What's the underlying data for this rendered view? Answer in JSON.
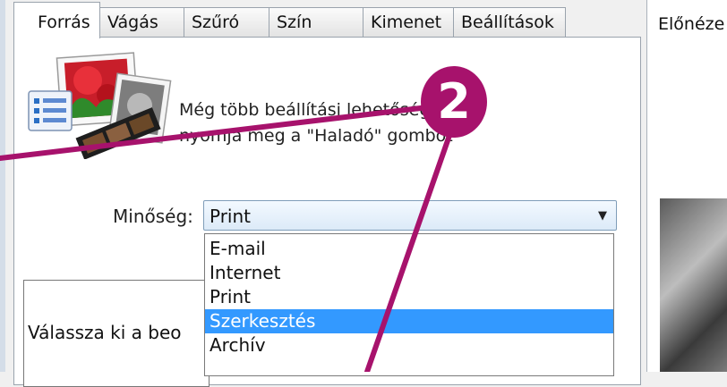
{
  "tabs": [
    {
      "label": "Forrás"
    },
    {
      "label": "Vágás"
    },
    {
      "label": "Szűró"
    },
    {
      "label": "Szín"
    },
    {
      "label": "Kimenet"
    },
    {
      "label": "Beállítások"
    }
  ],
  "hint": {
    "line1": "Még több beállítási lehetőség",
    "line2": "nyomja meg a \"Haladó\" gombot"
  },
  "quality": {
    "label": "Minőség:",
    "value": "Print",
    "options": [
      {
        "label": "E-mail",
        "selected": false
      },
      {
        "label": "Internet",
        "selected": false
      },
      {
        "label": "Print",
        "selected": false
      },
      {
        "label": "Szerkesztés",
        "selected": true
      },
      {
        "label": "Archív",
        "selected": false
      }
    ]
  },
  "description": {
    "text": "Válassza ki a beo"
  },
  "preview": {
    "label": "Előnéze"
  },
  "callout": {
    "number": "2",
    "color": "#a7126c"
  }
}
